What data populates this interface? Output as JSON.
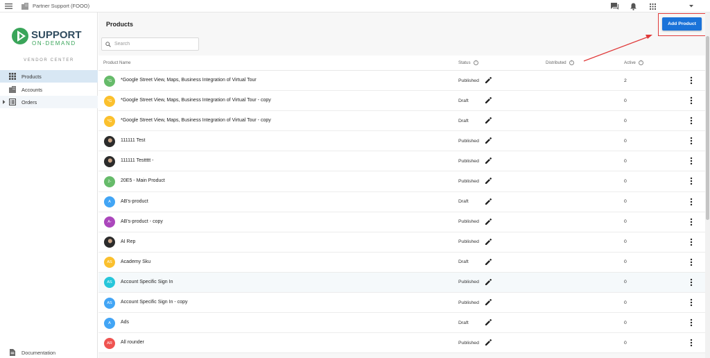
{
  "topbar": {
    "org_name": "Partner Support (FOOO)",
    "icons": [
      "menu-icon",
      "building-icon",
      "chat-icon",
      "bell-icon",
      "apps-grid-icon",
      "chevron-down-icon"
    ]
  },
  "sidebar": {
    "logo_main": "SUPPORT",
    "logo_sub": "ON-DEMAND",
    "section_label": "VENDOR CENTER",
    "items": [
      {
        "label": "Products",
        "icon": "grid-icon"
      },
      {
        "label": "Accounts",
        "icon": "building-icon"
      },
      {
        "label": "Orders",
        "icon": "list-icon"
      }
    ],
    "documentation_label": "Documentation"
  },
  "main": {
    "title": "Products",
    "add_button_label": "Add Product",
    "search_placeholder": "Search",
    "columns": {
      "name": "Product Name",
      "status": "Status",
      "distributed": "Distributed",
      "active": "Active"
    },
    "rows": [
      {
        "initials": "*G",
        "avatar_color": "#66bb6a",
        "name": "*Google Street View, Maps, Business Integration of Virtual Tour",
        "status": "Published",
        "active": "2"
      },
      {
        "initials": "*G",
        "avatar_color": "#fbc02d",
        "name": "*Google Street View, Maps, Business Integration of Virtual Tour - copy",
        "status": "Draft",
        "active": "0"
      },
      {
        "initials": "*G",
        "avatar_color": "#fbc02d",
        "name": "*Google Street View, Maps, Business Integration of Virtual Tour - copy",
        "status": "Draft",
        "active": "0"
      },
      {
        "initials": "",
        "avatar_color": "photo",
        "name": "111111 Test",
        "status": "Published",
        "active": "0"
      },
      {
        "initials": "",
        "avatar_color": "photo",
        "name": "111111 Testtttt -",
        "status": "Published",
        "active": "0"
      },
      {
        "initials": "2-",
        "avatar_color": "#66bb6a",
        "name": "20E5 - Main Product",
        "status": "Published",
        "active": "0"
      },
      {
        "initials": "A",
        "avatar_color": "#42a5f5",
        "name": "AB's-product",
        "status": "Draft",
        "active": "0"
      },
      {
        "initials": "A-",
        "avatar_color": "#ab47bc",
        "name": "AB's-product - copy",
        "status": "Published",
        "active": "0"
      },
      {
        "initials": "",
        "avatar_color": "photo",
        "name": "AI Rep",
        "status": "Published",
        "active": "0"
      },
      {
        "initials": "AS",
        "avatar_color": "#fbc02d",
        "name": "Academy Sku",
        "status": "Draft",
        "active": "0"
      },
      {
        "initials": "AS",
        "avatar_color": "#26c6da",
        "name": "Account Specific Sign In",
        "status": "Published",
        "active": "0"
      },
      {
        "initials": "AS",
        "avatar_color": "#42a5f5",
        "name": "Account Specific Sign In - copy",
        "status": "Published",
        "active": "0"
      },
      {
        "initials": "A",
        "avatar_color": "#42a5f5",
        "name": "Ads",
        "status": "Draft",
        "active": "0"
      },
      {
        "initials": "AR",
        "avatar_color": "#ef5350",
        "name": "All rounder",
        "status": "Published",
        "active": "0"
      }
    ]
  },
  "colors": {
    "accent": "#1a73d9",
    "highlight": "#e03a3a",
    "nav_active_bg": "#d8e7f4"
  }
}
